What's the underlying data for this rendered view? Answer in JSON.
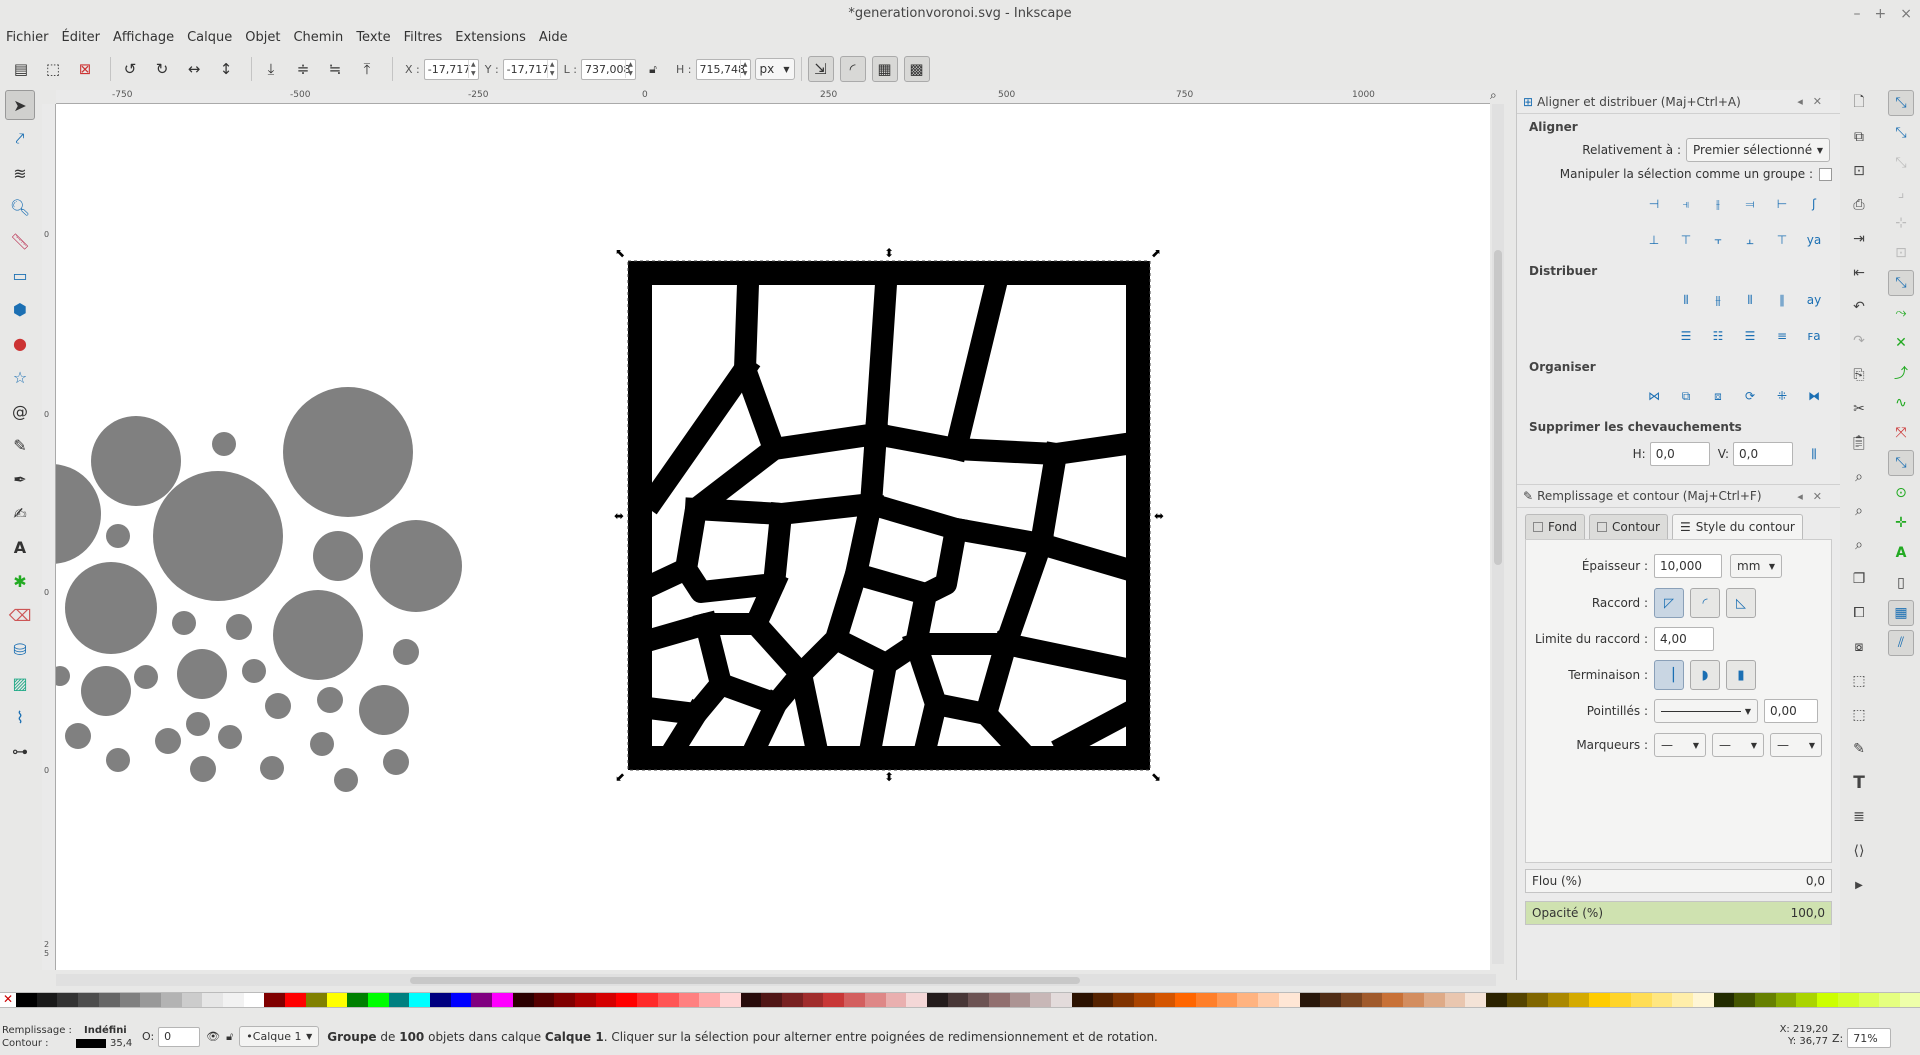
{
  "window": {
    "title": "*generationvoronoi.svg - Inkscape",
    "controls": [
      "–",
      "+",
      "×"
    ]
  },
  "menu": [
    "Fichier",
    "Éditer",
    "Affichage",
    "Calque",
    "Objet",
    "Chemin",
    "Texte",
    "Filtres",
    "Extensions",
    "Aide"
  ],
  "toolbar": {
    "x_label": "X :",
    "x_value": "-17,717",
    "y_label": "Y :",
    "y_value": "-17,717",
    "w_label": "L :",
    "w_value": "737,008",
    "h_label": "H :",
    "h_value": "715,748",
    "unit": "px"
  },
  "ruler_ticks": [
    "-750",
    "-500",
    "-250",
    "0",
    "250",
    "500",
    "750",
    "1000"
  ],
  "ruler_v_ticks": [
    "0",
    "0",
    "0",
    "0",
    "0",
    "0",
    "2 5"
  ],
  "align_panel": {
    "title": "Aligner et distribuer (Maj+Ctrl+A)",
    "aligner": "Aligner",
    "relative_label": "Relativement à :",
    "relative_value": "Premier sélectionné",
    "group_label": "Manipuler la sélection comme un groupe :",
    "distribuer": "Distribuer",
    "organiser": "Organiser",
    "overlap": "Supprimer les chevauchements",
    "h_label": "H:",
    "h_value": "0,0",
    "v_label": "V:",
    "v_value": "0,0"
  },
  "fill_panel": {
    "title": "Remplissage et contour (Maj+Ctrl+F)",
    "tab_fond": "Fond",
    "tab_contour": "Contour",
    "tab_style": "Style du contour",
    "width_label": "Épaisseur :",
    "width_value": "10,000",
    "width_unit": "mm",
    "join_label": "Raccord :",
    "miter_label": "Limite du raccord :",
    "miter_value": "4,00",
    "cap_label": "Terminaison :",
    "dash_label": "Pointillés :",
    "dash_value": "0,00",
    "markers_label": "Marqueurs :",
    "blur_label": "Flou (%)",
    "blur_value": "0,0",
    "opacity_label": "Opacité (%)",
    "opacity_value": "100,0"
  },
  "status": {
    "fill_label": "Remplissage :",
    "fill_value": "Indéfini",
    "stroke_label": "Contour :",
    "stroke_width": "35,4",
    "o_label": "O:",
    "o_value": "0",
    "layer": "•Calque 1",
    "message_b1": "Groupe",
    "message_t1": " de ",
    "message_b2": "100",
    "message_t2": " objets dans calque ",
    "message_b3": "Calque 1",
    "message_t3": ". Cliquer sur la sélection pour alterner entre poignées de redimensionnement et de rotation.",
    "x_label": "X:",
    "x_value": "219,20",
    "y_label": "Y:",
    "y_value": "36,77",
    "z_label": "Z:",
    "zoom": "71%"
  },
  "palette_colors": [
    "#000000",
    "#1a1a1a",
    "#333333",
    "#4d4d4d",
    "#666666",
    "#808080",
    "#999999",
    "#b3b3b3",
    "#cccccc",
    "#e6e6e6",
    "#f2f2f2",
    "#ffffff",
    "#800000",
    "#ff0000",
    "#808000",
    "#ffff00",
    "#008000",
    "#00ff00",
    "#008080",
    "#00ffff",
    "#000080",
    "#0000ff",
    "#800080",
    "#ff00ff",
    "#2b0000",
    "#550000",
    "#800000",
    "#aa0000",
    "#d40000",
    "#ff0000",
    "#ff2a2a",
    "#ff5555",
    "#ff8080",
    "#ffaaaa",
    "#ffd5d5",
    "#280b0b",
    "#501616",
    "#782121",
    "#a02c2c",
    "#c83737",
    "#d35f5f",
    "#de8787",
    "#e9afaf",
    "#f4d7d7",
    "#241c1c",
    "#483737",
    "#6c5353",
    "#916f6f",
    "#ac9393",
    "#c8b7b7",
    "#e3dbdb",
    "#2b1100",
    "#552200",
    "#803300",
    "#aa4400",
    "#d45500",
    "#ff6600",
    "#ff7f2a",
    "#ff9955",
    "#ffb380",
    "#ffccaa",
    "#ffe6d5",
    "#28170b",
    "#502d16",
    "#784421",
    "#a05a2c",
    "#c87137",
    "#d38d5f",
    "#deaa87",
    "#e9c6af",
    "#f4e3d7",
    "#2b2200",
    "#554400",
    "#806600",
    "#aa8800",
    "#d4aa00",
    "#ffcc00",
    "#ffd42a",
    "#ffdd55",
    "#ffe680",
    "#ffeeaa",
    "#fff6d5",
    "#222b00",
    "#445500",
    "#668000",
    "#88aa00",
    "#aad400",
    "#ccff00",
    "#d4ff2a",
    "#ddff55",
    "#e5ff80",
    "#eeffaa"
  ]
}
